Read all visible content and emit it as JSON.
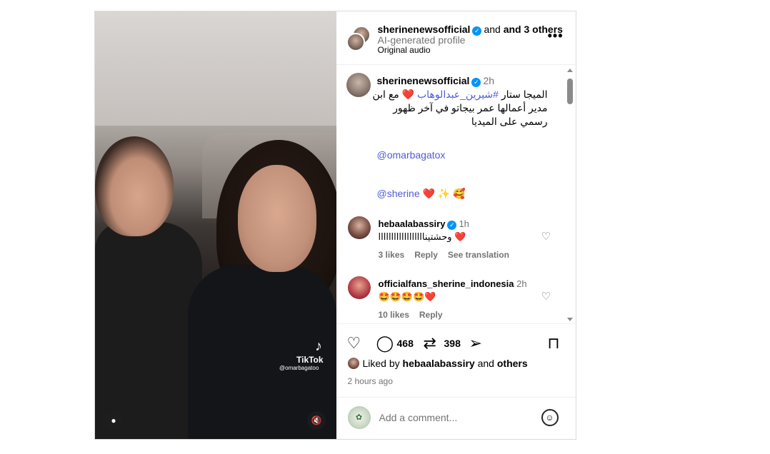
{
  "header": {
    "username": "sherinenewsofficial",
    "and_others": "and 3 others",
    "subtitle": "AI-generated profile",
    "audio": "Original audio"
  },
  "caption": {
    "username": "sherinenewsofficial",
    "time": "2h",
    "text_prefix": "الميجا ستار ",
    "hashtag": "#شيرين_عبدالوهاب",
    "text_suffix": " مع ابن مدير أعمالها عمر بيجاتو في آخر ظهور رسمي على الميديا",
    "mention1": "@omarbagatox",
    "mention2": "@sherine",
    "mention2_emojis": "❤️ ✨ 🥰"
  },
  "comments": [
    {
      "username": "hebaalabassiry",
      "time": "1h",
      "text": "وحشتيناااااااااااااااااا ❤️",
      "likes": "3 likes",
      "reply": "Reply",
      "translate": "See translation"
    },
    {
      "username": "officialfans_sherine_indonesia",
      "time": "2h",
      "text": "🤩🤩🤩🤩❤️",
      "likes": "10 likes",
      "reply": "Reply"
    }
  ],
  "actions": {
    "comment_count": "468",
    "repost_count": "398"
  },
  "liked_by": {
    "prefix": "Liked by ",
    "user": "hebaalabassiry",
    "middle": " and ",
    "others": "others"
  },
  "time_ago": "2 hours ago",
  "add_comment": {
    "placeholder": "Add a comment..."
  },
  "media": {
    "watermark_brand": "TikTok",
    "watermark_handle": "@omarbagatoo"
  },
  "colors": {
    "link": "#4f5bd5",
    "verified": "#0095f6",
    "muted": "#737373"
  }
}
